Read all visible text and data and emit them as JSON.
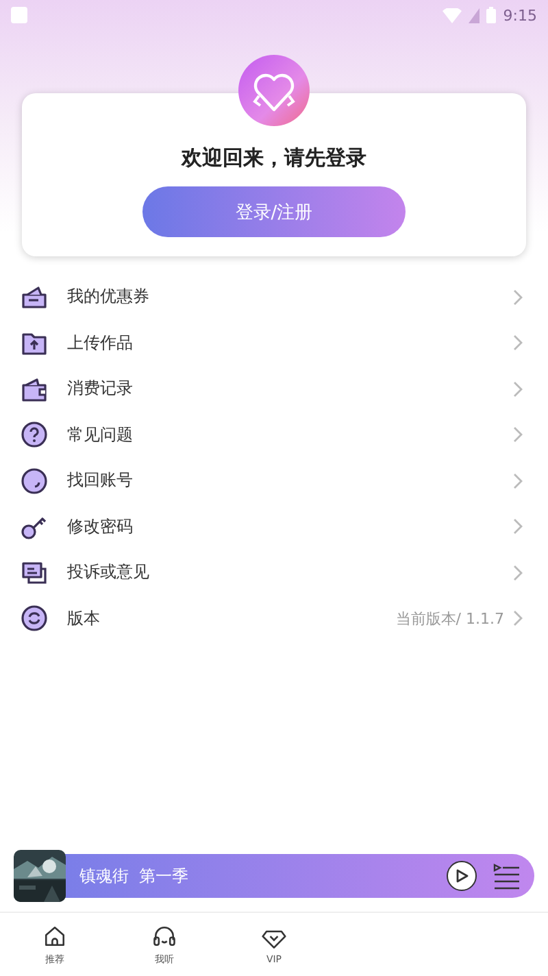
{
  "status_bar": {
    "time": "9:15"
  },
  "login_card": {
    "greeting": "欢迎回来，请先登录",
    "button": "登录/注册"
  },
  "menu": [
    {
      "kind": "coupon",
      "label": "我的优惠券"
    },
    {
      "kind": "upload",
      "label": "上传作品"
    },
    {
      "kind": "wallet",
      "label": "消费记录"
    },
    {
      "kind": "question",
      "label": "常见问题"
    },
    {
      "kind": "circle",
      "label": "找回账号"
    },
    {
      "kind": "key",
      "label": "修改密码"
    },
    {
      "kind": "chat",
      "label": "投诉或意见"
    },
    {
      "kind": "refresh",
      "label": "版本",
      "value": "当前版本/ 1.1.7"
    }
  ],
  "player": {
    "title": "镇魂街  第一季"
  },
  "tabs": [
    {
      "kind": "home",
      "label": "推荐",
      "selected": false
    },
    {
      "kind": "headphones",
      "label": "我听",
      "selected": false
    },
    {
      "kind": "diamond",
      "label": "VIP",
      "selected": false
    }
  ]
}
